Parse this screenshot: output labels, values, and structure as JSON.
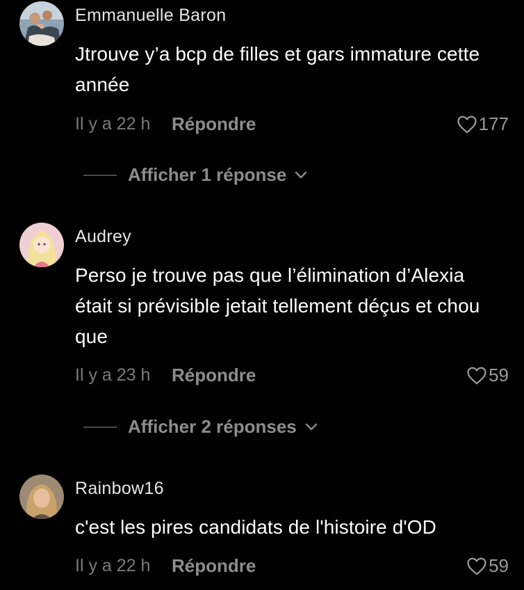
{
  "comments": [
    {
      "username": "Emmanuelle Baron",
      "text": "Jtrouve y’a bcp de filles et gars immature cette année",
      "time": "Il y a 22 h",
      "reply_label": "Répondre",
      "likes": "177",
      "replies_label": "Afficher 1 réponse",
      "avatar_icon": "user-photo-group"
    },
    {
      "username": "Audrey",
      "text": "Perso je trouve pas que l’élimination d’Alexia était si prévisible jetait tellement déçus et chou que",
      "time": "Il y a 23 h",
      "reply_label": "Répondre",
      "likes": "59",
      "replies_label": "Afficher 2 réponses",
      "avatar_icon": "user-photo-cartoon"
    },
    {
      "username": "Rainbow16",
      "text": "c'est les pires candidats de l'histoire d'OD",
      "time": "Il y a 22 h",
      "reply_label": "Répondre",
      "likes": "59",
      "avatar_icon": "user-photo-portrait"
    }
  ],
  "colors": {
    "background": "#000000",
    "username": "#e6e6e6",
    "text": "#ffffff",
    "meta": "#8d8d8d"
  }
}
